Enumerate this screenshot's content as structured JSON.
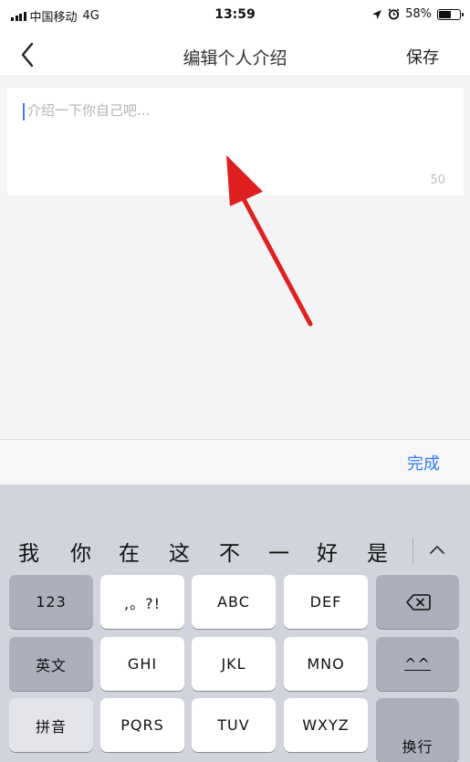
{
  "status_bar": {
    "carrier": "中国移动",
    "network": "4G",
    "time": "13:59",
    "battery_percent": "58%",
    "battery_level": 0.58,
    "icons": [
      "location-arrow-icon",
      "alarm-icon",
      "battery-icon"
    ]
  },
  "nav": {
    "back_icon": "chevron-left-icon",
    "back_glyph": "〈",
    "title": "编辑个人介绍",
    "save_label": "保存"
  },
  "editor": {
    "placeholder": "介绍一下你自己吧...",
    "value": "",
    "char_limit": "50"
  },
  "accessory": {
    "done_label": "完成"
  },
  "keyboard": {
    "candidates": [
      "我",
      "你",
      "在",
      "这",
      "不",
      "一",
      "好",
      "是"
    ],
    "collapse_icon": "chevron-up-icon",
    "keys": {
      "num": "123",
      "punct": ",。?!",
      "abc": "ABC",
      "def": "DEF",
      "delete_icon": "backspace-icon",
      "english": "英文",
      "ghi": "GHI",
      "jkl": "JKL",
      "mno": "MNO",
      "emoticon": "^^",
      "pinyin": "拼音",
      "pqrs": "PQRS",
      "tuv": "TUV",
      "wxyz": "WXYZ",
      "return": "换行"
    }
  },
  "annotation": {
    "arrow_color": "#e02020"
  },
  "colors": {
    "accent": "#2f7ef6",
    "caret": "#3d7bf7"
  }
}
